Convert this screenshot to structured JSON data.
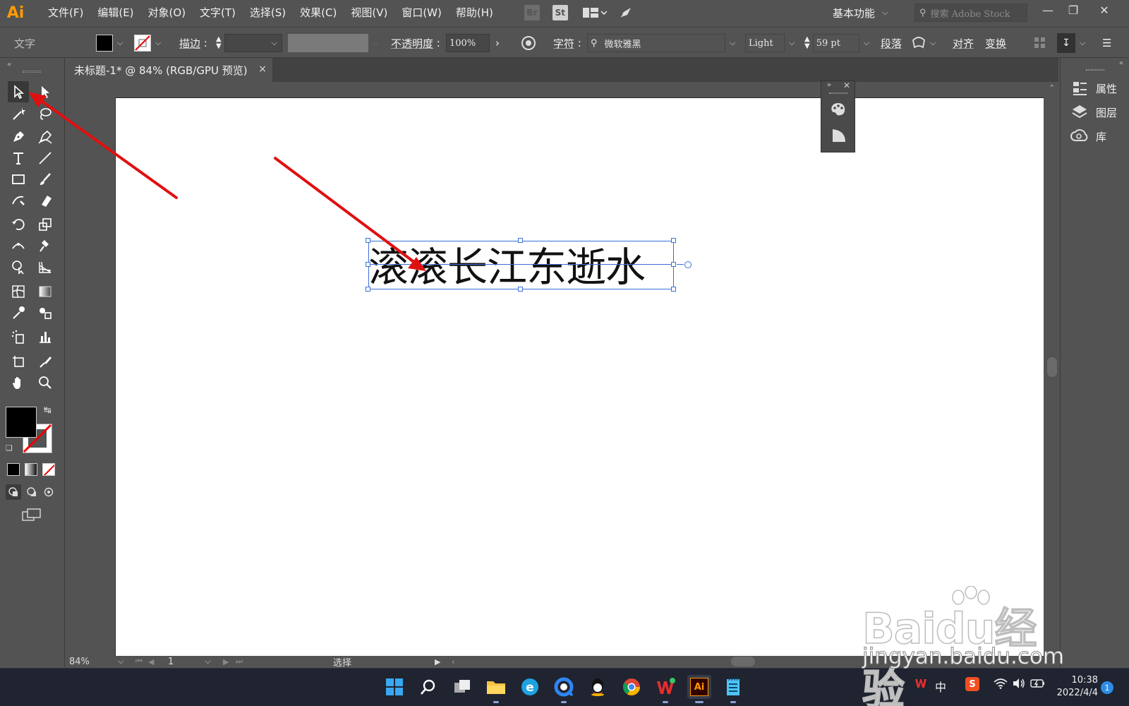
{
  "app": {
    "logo": "Ai"
  },
  "menu": [
    "文件(F)",
    "编辑(E)",
    "对象(O)",
    "文字(T)",
    "选择(S)",
    "效果(C)",
    "视图(V)",
    "窗口(W)",
    "帮助(H)"
  ],
  "menubar_apps": {
    "bridge": "Br",
    "stock": "St"
  },
  "workspace_label": "基本功能",
  "search_placeholder": "搜索 Adobe Stock",
  "control_bar": {
    "mode_label": "文字",
    "stroke_label": "描边",
    "opacity_label": "不透明度",
    "opacity_value": "100%",
    "character_label": "字符",
    "font_family": "微软雅黑",
    "font_style": "Light",
    "font_size": "59 pt",
    "paragraph_label": "段落",
    "align_label": "对齐",
    "transform_label": "变换"
  },
  "document_tab": {
    "title": "未标题-1* @ 84% (RGB/GPU 预览)",
    "close": "×"
  },
  "canvas": {
    "text": "滚滚长江东逝水"
  },
  "right_panels": [
    "属性",
    "图层",
    "库"
  ],
  "status_bar": {
    "zoom": "84%",
    "artboard": "1",
    "tool_name": "选择"
  },
  "taskbar": {
    "time": "10:38",
    "date": "2022/4/4",
    "ime": "中",
    "notification_count": "1"
  },
  "colors": {
    "accent": "#ff9a00",
    "selection": "#3a6fd8",
    "arrow": "#e01010"
  },
  "watermark": {
    "logo": "Baidu经验",
    "url": "jingyan.baidu.com"
  }
}
